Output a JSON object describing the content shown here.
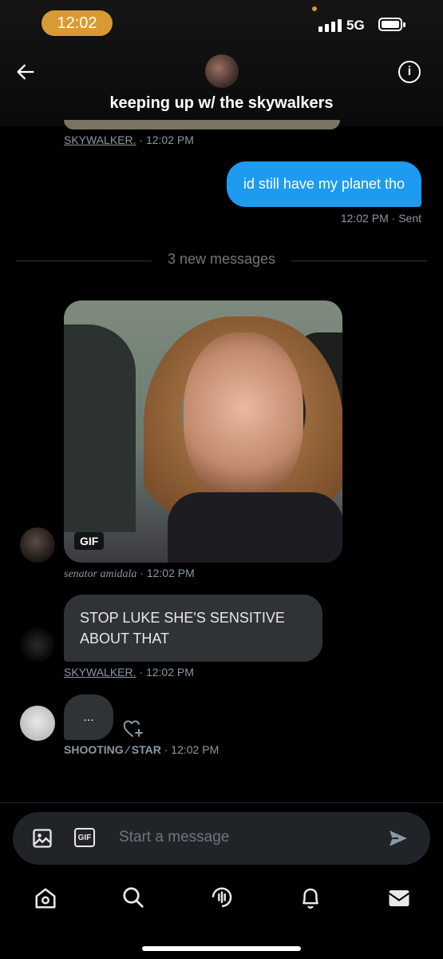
{
  "status_bar": {
    "time": "12:02",
    "network": "5G"
  },
  "header": {
    "title": "keeping up w/ the skywalkers"
  },
  "messages": [
    {
      "kind": "meta",
      "sender": "SKYWALKER.",
      "time": "· 12:02 PM"
    },
    {
      "kind": "sent",
      "text": "id still have my planet tho",
      "time": "12:02 PM",
      "status": "· Sent"
    },
    {
      "kind": "divider",
      "text": "3 new messages"
    },
    {
      "kind": "gif",
      "badge": "GIF",
      "sender": "senator amidala",
      "time": "· 12:02 PM"
    },
    {
      "kind": "text",
      "text": "STOP LUKE SHE'S SENSITIVE ABOUT THAT",
      "sender": "SKYWALKER.",
      "time": "· 12:02 PM"
    },
    {
      "kind": "typing",
      "text": "...",
      "sender": "SHOOTING ⁄ STAR",
      "time": "· 12:02 PM"
    }
  ],
  "composer": {
    "placeholder": "Start a message",
    "gif_label": "GIF"
  },
  "icons": [
    "back-arrow-icon",
    "info-icon",
    "image-icon",
    "gif-icon",
    "send-icon",
    "home-icon",
    "search-icon",
    "spaces-icon",
    "bell-icon",
    "mail-icon",
    "heart-plus-icon"
  ],
  "colors": {
    "accent": "#1d9bf0",
    "bubble": "#2f3336",
    "time_pill": "#d89a32"
  }
}
